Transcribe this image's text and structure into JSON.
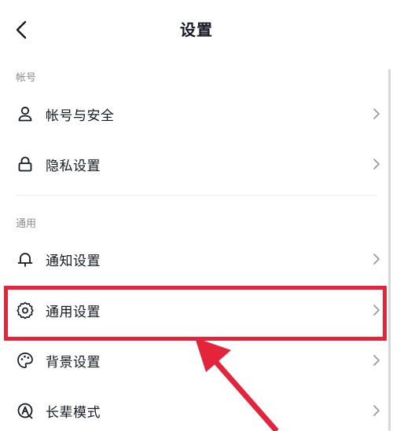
{
  "header": {
    "title": "设置",
    "back_icon": "chevron-left-icon"
  },
  "sections": [
    {
      "label": "帐号",
      "items": [
        {
          "label": "帐号与安全",
          "icon": "user-icon"
        },
        {
          "label": "隐私设置",
          "icon": "lock-icon"
        }
      ]
    },
    {
      "label": "通用",
      "items": [
        {
          "label": "通知设置",
          "icon": "bell-icon"
        },
        {
          "label": "通用设置",
          "icon": "gear-icon"
        },
        {
          "label": "背景设置",
          "icon": "palette-icon"
        },
        {
          "label": "长辈模式",
          "icon": "elder-mode-icon"
        }
      ]
    }
  ],
  "annotation": {
    "highlight_color": "#e3243b",
    "highlighted_item": "通用设置"
  }
}
